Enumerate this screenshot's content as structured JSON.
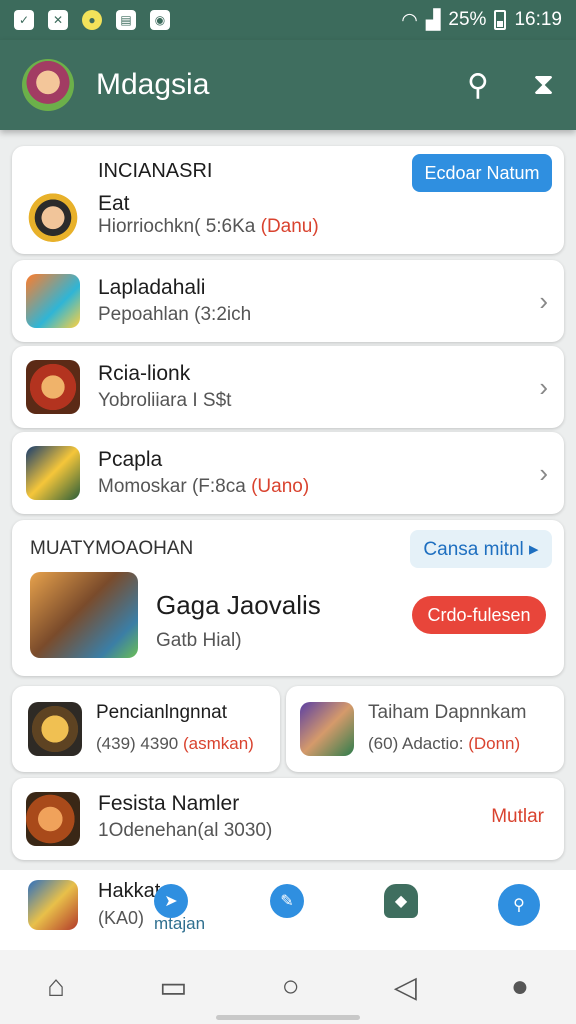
{
  "status": {
    "battery": "25%",
    "time": "16:19"
  },
  "app": {
    "title": "Mdagsia"
  },
  "featured": {
    "header": "INCIANASRI",
    "button": "Ecdoar Natum",
    "name": "Eat",
    "sub": "Hiorriochkn( 5:6Ka",
    "sub_tag": "(Danu)"
  },
  "list": [
    {
      "name": "Lapladahali",
      "sub": "Pepoahlan (3:2ich",
      "sub_tag": ""
    },
    {
      "name": "Rcia-lionk",
      "sub": "Yobroliiara I S$t",
      "sub_tag": ""
    },
    {
      "name": "Pcapla",
      "sub": "Momoskar (F:8ca",
      "sub_tag": "(Uano)"
    }
  ],
  "promo": {
    "header": "MUATYMOAOHAN",
    "link": "Cansa mitnl ▸",
    "title": "Gaga Jaovalis",
    "sub": "Gatb Hial)",
    "button": "Crdo-fulesen"
  },
  "tiles": [
    {
      "name": "Pencianlngnnat",
      "sub": "(439)  4390",
      "sub_tag": "(asmkan)"
    },
    {
      "name": "Taiham Dapnnkam",
      "sub": "(60)  Adactio:",
      "sub_tag": "(Donn)"
    }
  ],
  "last": {
    "name": "Fesista Namler",
    "sub": "1Odenehan(al 3030)",
    "action": "Mutlar"
  },
  "partial": {
    "name": "Hakkat",
    "sub": "(KA0)",
    "tab_label": "mtajan"
  }
}
